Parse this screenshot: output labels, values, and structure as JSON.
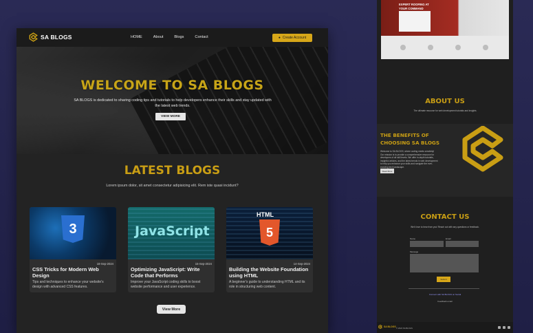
{
  "nav": {
    "logo_text": "SA BLOGS",
    "links": [
      "HOME",
      "About",
      "Blogs",
      "Contact"
    ],
    "create_account": "Create Account"
  },
  "hero": {
    "title": "WELCOME TO SA BLOGS",
    "description": "SA BLOGS is dedicated to sharing coding tips and tutorials to help developers enhance their skills and stay updated with the latest web trends.",
    "button": "VIEW MORE"
  },
  "latest": {
    "title": "LATEST BLOGS",
    "subtitle": "Lorem ipsum dolor, sit amet consectetur adipisicing elit. Rem iste quasi incidunt?"
  },
  "cards": [
    {
      "badge": "3",
      "date": "18-Sep-2024",
      "title": "CSS Tricks for Modern Web Design",
      "description": "Tips and techniques to enhance your website's design with advanced CSS features."
    },
    {
      "badge": "JavaScript",
      "date": "15-Sep-2024",
      "title": "Optimizing JavaScript: Write Code that Performs",
      "description": "Improve your JavaScript coding skills to boost website performance and user experience."
    },
    {
      "badge": "5",
      "badge_label": "HTML",
      "date": "14-Sep-2024",
      "title": "Building the Website Foundation using HTML",
      "description": "A beginner's guide to understanding HTML and its role in structuring web content."
    }
  ],
  "view_more": "View More",
  "side": {
    "banner_text": "EXPERT ROOFING AT YOUR COMMAND",
    "about_title": "ABOUT US",
    "about_text": "The ultimate resource for web development tutorials and insights",
    "benefits_title": "THE BENEFITS OF CHOOSING SA BLOGS",
    "benefits_text": "Welcome to SA BLOGS, where coding meets creativity! Our mission is to provide a comprehensive resource for developers of all skill levels. We offer in-depth tutorials, insightful articles, and the latest trends in web development to help you enhance your skills and navigate the ever-evolving tech landscape.",
    "benefits_button": "Read More",
    "contact_title": "CONTACT US",
    "contact_text": "We'd love to hear from you! Reach out with any questions or feedback.",
    "name_label": "Name",
    "email_label": "Email",
    "message_label": "Message",
    "submit": "Submit",
    "link_text": "Connect with SA BLOGS on Social",
    "follow_text": "Feedback email",
    "footer_logo": "SA BLOGS",
    "footer_copy": "© 2024 SA BLOGS"
  },
  "colors": {
    "accent": "#c99e14",
    "button_yellow": "#d7a719",
    "bg": "#232323"
  }
}
